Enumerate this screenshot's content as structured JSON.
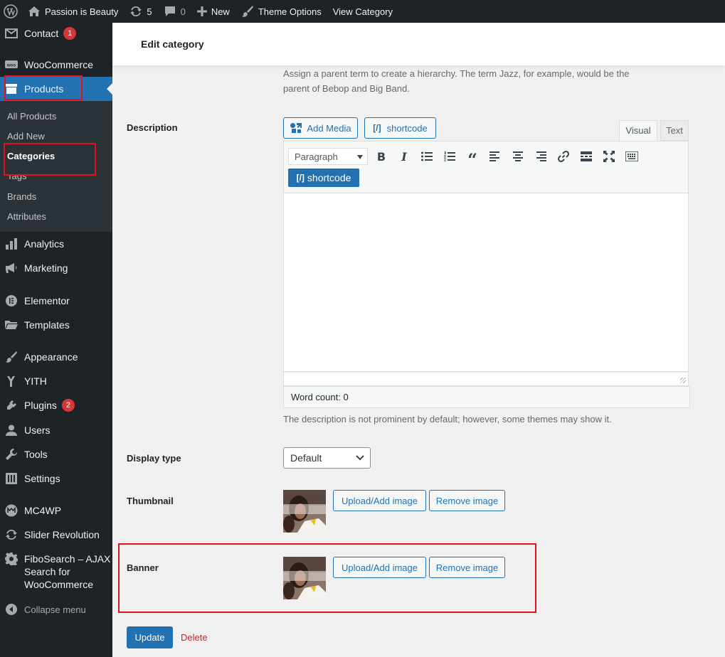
{
  "admin_bar": {
    "site_name": "Passion is Beauty",
    "updates_count": "5",
    "comments_count": "0",
    "new_label": "New",
    "theme_options": "Theme Options",
    "view_category": "View Category"
  },
  "sidebar": {
    "contact": {
      "label": "Contact",
      "badge": "1"
    },
    "woocommerce": "WooCommerce",
    "products": "Products",
    "submenu": [
      "All Products",
      "Add New",
      "Categories",
      "Tags",
      "Brands",
      "Attributes"
    ],
    "analytics": "Analytics",
    "marketing": "Marketing",
    "elementor": "Elementor",
    "templates": "Templates",
    "appearance": "Appearance",
    "yith": "YITH",
    "plugins": {
      "label": "Plugins",
      "badge": "2"
    },
    "users": "Users",
    "tools": "Tools",
    "settings": "Settings",
    "mc4wp": "MC4WP",
    "slider_revolution": "Slider Revolution",
    "fibosearch": [
      "FiboSearch – AJAX",
      "Search for",
      "WooCommerce"
    ],
    "collapse": "Collapse menu"
  },
  "page": {
    "title": "Edit category",
    "parent_help": [
      "Assign a parent term to create a hierarchy. The term Jazz, for example, would be the",
      "parent of Bebop and Big Band."
    ],
    "description_label": "Description",
    "add_media": "Add Media",
    "shortcode": "shortcode",
    "tab_visual": "Visual",
    "tab_text": "Text",
    "format_value": "Paragraph",
    "toolbar_shortcode": "shortcode",
    "word_count": "Word count: 0",
    "description_help": "The description is not prominent by default; however, some themes may show it.",
    "display_type_label": "Display type",
    "display_type_value": "Default",
    "thumbnail_label": "Thumbnail",
    "banner_label": "Banner",
    "upload_image": "Upload/Add image",
    "remove_image": "Remove image",
    "update_button": "Update",
    "delete_link": "Delete"
  },
  "colors": {
    "admin_dark": "#1d2327",
    "accent_blue": "#2271b1",
    "badge_red": "#d63638",
    "highlight_red": "#e0141e",
    "delete_red": "#b32d2e"
  }
}
